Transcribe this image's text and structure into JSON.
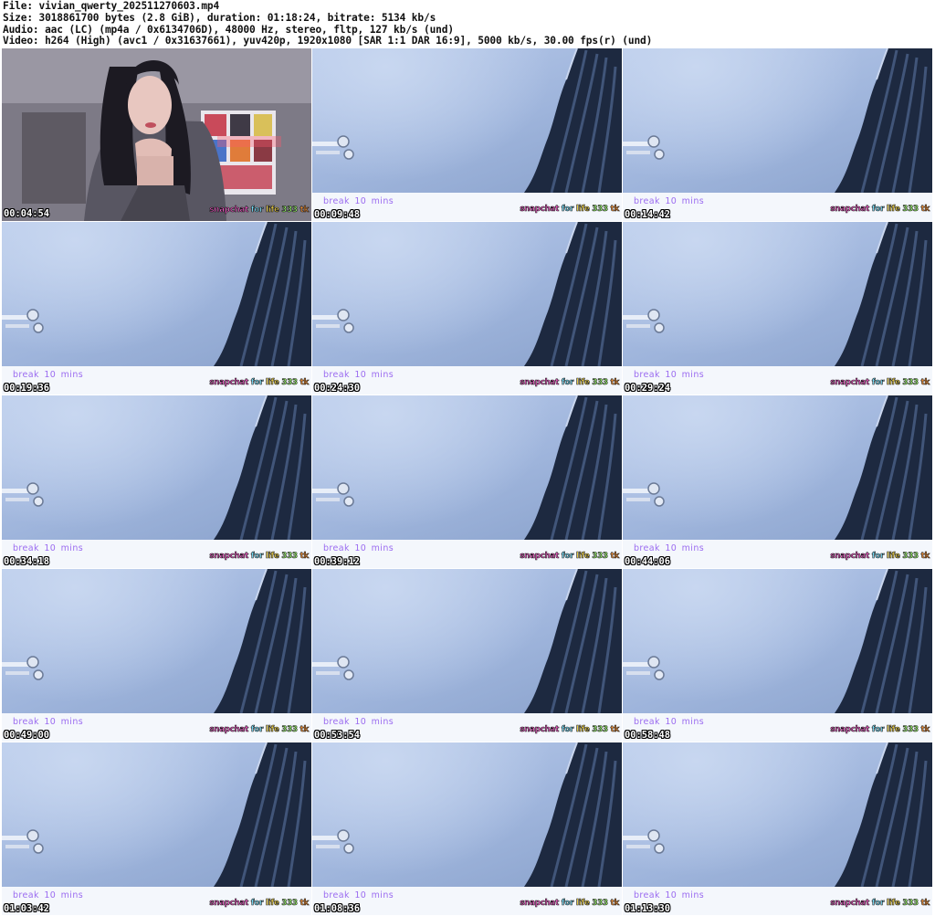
{
  "header": {
    "file_line": "File: vivian_qwerty_202511270603.mp4",
    "size_line": "Size: 3018861700 bytes (2.8 GiB), duration: 01:18:24, bitrate: 5134 kb/s",
    "audio_line": "Audio: aac (LC) (mp4a / 0x6134706D), 48000 Hz, stereo, fltp, 127 kb/s (und)",
    "video_line": "Video: h264 (High) (avc1 / 0x31637661), yuv420p, 1920x1080 [SAR 1:1 DAR 16:9], 5000 kb/s, 30.00 fps(r) (und)"
  },
  "overlay": {
    "break_text": "break  10  mins",
    "promo_words": [
      "snapchat",
      "for",
      "life",
      "333",
      "tk"
    ],
    "promo_colors": [
      "#ff5fd2",
      "#7be3ff",
      "#ffe14d",
      "#9cff6b",
      "#ff9a3d"
    ]
  },
  "thumbnails": [
    {
      "timestamp": "00:04:54",
      "scene": "webcam"
    },
    {
      "timestamp": "00:09:48",
      "scene": "break"
    },
    {
      "timestamp": "00:14:42",
      "scene": "break"
    },
    {
      "timestamp": "00:19:36",
      "scene": "break"
    },
    {
      "timestamp": "00:24:30",
      "scene": "break"
    },
    {
      "timestamp": "00:29:24",
      "scene": "break"
    },
    {
      "timestamp": "00:34:18",
      "scene": "break"
    },
    {
      "timestamp": "00:39:12",
      "scene": "break"
    },
    {
      "timestamp": "00:44:06",
      "scene": "break"
    },
    {
      "timestamp": "00:49:00",
      "scene": "break"
    },
    {
      "timestamp": "00:53:54",
      "scene": "break"
    },
    {
      "timestamp": "00:58:48",
      "scene": "break"
    },
    {
      "timestamp": "01:03:42",
      "scene": "break"
    },
    {
      "timestamp": "01:08:36",
      "scene": "break"
    },
    {
      "timestamp": "01:13:30",
      "scene": "break"
    }
  ]
}
